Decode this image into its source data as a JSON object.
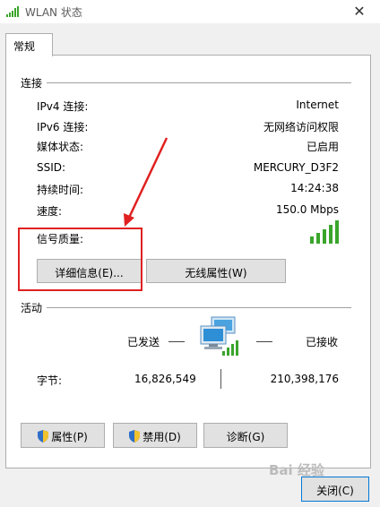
{
  "window": {
    "title": "WLAN 状态",
    "close_glyph": "✕"
  },
  "tab": {
    "label": "常规"
  },
  "connection": {
    "section_label": "连接",
    "rows": [
      {
        "label": "IPv4 连接:",
        "value": "Internet"
      },
      {
        "label": "IPv6 连接:",
        "value": "无网络访问权限"
      },
      {
        "label": "媒体状态:",
        "value": "已启用"
      },
      {
        "label": "SSID:",
        "value": "MERCURY_D3F2"
      },
      {
        "label": "持续时间:",
        "value": "14:24:38"
      },
      {
        "label": "速度:",
        "value": "150.0 Mbps"
      }
    ],
    "signal_label": "信号质量:",
    "signal_bars": 5,
    "details_button": "详细信息(E)...",
    "wireless_props_button": "无线属性(W)"
  },
  "activity": {
    "section_label": "活动",
    "sent_label": "已发送",
    "received_label": "已接收",
    "bytes_label": "字节:",
    "bytes_sent": "16,826,549",
    "bytes_received": "210,398,176"
  },
  "buttons": {
    "properties": "属性(P)",
    "disable": "禁用(D)",
    "diagnose": "诊断(G)",
    "close": "关闭(C)"
  },
  "watermark": "Bai 经验",
  "colors": {
    "signal_green": "#3aa52b",
    "annotation_red": "#e02020",
    "accent": "#0078d7"
  }
}
